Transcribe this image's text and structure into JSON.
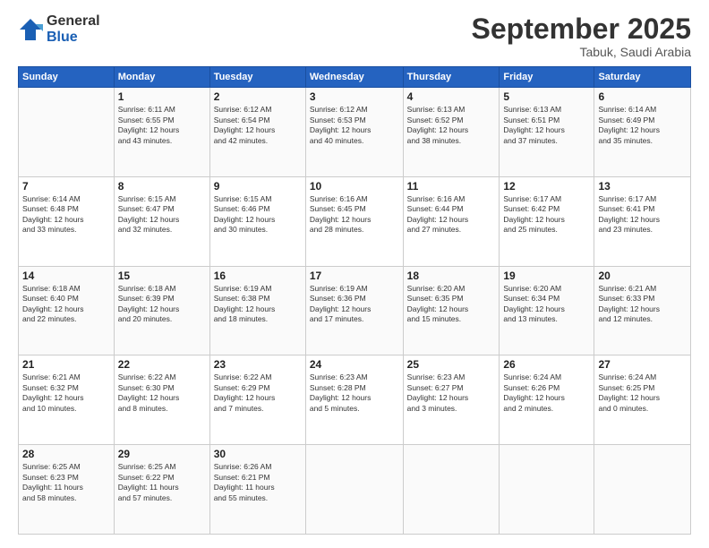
{
  "logo": {
    "general": "General",
    "blue": "Blue"
  },
  "header": {
    "month": "September 2025",
    "location": "Tabuk, Saudi Arabia"
  },
  "weekdays": [
    "Sunday",
    "Monday",
    "Tuesday",
    "Wednesday",
    "Thursday",
    "Friday",
    "Saturday"
  ],
  "weeks": [
    [
      {
        "day": "",
        "text": ""
      },
      {
        "day": "1",
        "text": "Sunrise: 6:11 AM\nSunset: 6:55 PM\nDaylight: 12 hours\nand 43 minutes."
      },
      {
        "day": "2",
        "text": "Sunrise: 6:12 AM\nSunset: 6:54 PM\nDaylight: 12 hours\nand 42 minutes."
      },
      {
        "day": "3",
        "text": "Sunrise: 6:12 AM\nSunset: 6:53 PM\nDaylight: 12 hours\nand 40 minutes."
      },
      {
        "day": "4",
        "text": "Sunrise: 6:13 AM\nSunset: 6:52 PM\nDaylight: 12 hours\nand 38 minutes."
      },
      {
        "day": "5",
        "text": "Sunrise: 6:13 AM\nSunset: 6:51 PM\nDaylight: 12 hours\nand 37 minutes."
      },
      {
        "day": "6",
        "text": "Sunrise: 6:14 AM\nSunset: 6:49 PM\nDaylight: 12 hours\nand 35 minutes."
      }
    ],
    [
      {
        "day": "7",
        "text": "Sunrise: 6:14 AM\nSunset: 6:48 PM\nDaylight: 12 hours\nand 33 minutes."
      },
      {
        "day": "8",
        "text": "Sunrise: 6:15 AM\nSunset: 6:47 PM\nDaylight: 12 hours\nand 32 minutes."
      },
      {
        "day": "9",
        "text": "Sunrise: 6:15 AM\nSunset: 6:46 PM\nDaylight: 12 hours\nand 30 minutes."
      },
      {
        "day": "10",
        "text": "Sunrise: 6:16 AM\nSunset: 6:45 PM\nDaylight: 12 hours\nand 28 minutes."
      },
      {
        "day": "11",
        "text": "Sunrise: 6:16 AM\nSunset: 6:44 PM\nDaylight: 12 hours\nand 27 minutes."
      },
      {
        "day": "12",
        "text": "Sunrise: 6:17 AM\nSunset: 6:42 PM\nDaylight: 12 hours\nand 25 minutes."
      },
      {
        "day": "13",
        "text": "Sunrise: 6:17 AM\nSunset: 6:41 PM\nDaylight: 12 hours\nand 23 minutes."
      }
    ],
    [
      {
        "day": "14",
        "text": "Sunrise: 6:18 AM\nSunset: 6:40 PM\nDaylight: 12 hours\nand 22 minutes."
      },
      {
        "day": "15",
        "text": "Sunrise: 6:18 AM\nSunset: 6:39 PM\nDaylight: 12 hours\nand 20 minutes."
      },
      {
        "day": "16",
        "text": "Sunrise: 6:19 AM\nSunset: 6:38 PM\nDaylight: 12 hours\nand 18 minutes."
      },
      {
        "day": "17",
        "text": "Sunrise: 6:19 AM\nSunset: 6:36 PM\nDaylight: 12 hours\nand 17 minutes."
      },
      {
        "day": "18",
        "text": "Sunrise: 6:20 AM\nSunset: 6:35 PM\nDaylight: 12 hours\nand 15 minutes."
      },
      {
        "day": "19",
        "text": "Sunrise: 6:20 AM\nSunset: 6:34 PM\nDaylight: 12 hours\nand 13 minutes."
      },
      {
        "day": "20",
        "text": "Sunrise: 6:21 AM\nSunset: 6:33 PM\nDaylight: 12 hours\nand 12 minutes."
      }
    ],
    [
      {
        "day": "21",
        "text": "Sunrise: 6:21 AM\nSunset: 6:32 PM\nDaylight: 12 hours\nand 10 minutes."
      },
      {
        "day": "22",
        "text": "Sunrise: 6:22 AM\nSunset: 6:30 PM\nDaylight: 12 hours\nand 8 minutes."
      },
      {
        "day": "23",
        "text": "Sunrise: 6:22 AM\nSunset: 6:29 PM\nDaylight: 12 hours\nand 7 minutes."
      },
      {
        "day": "24",
        "text": "Sunrise: 6:23 AM\nSunset: 6:28 PM\nDaylight: 12 hours\nand 5 minutes."
      },
      {
        "day": "25",
        "text": "Sunrise: 6:23 AM\nSunset: 6:27 PM\nDaylight: 12 hours\nand 3 minutes."
      },
      {
        "day": "26",
        "text": "Sunrise: 6:24 AM\nSunset: 6:26 PM\nDaylight: 12 hours\nand 2 minutes."
      },
      {
        "day": "27",
        "text": "Sunrise: 6:24 AM\nSunset: 6:25 PM\nDaylight: 12 hours\nand 0 minutes."
      }
    ],
    [
      {
        "day": "28",
        "text": "Sunrise: 6:25 AM\nSunset: 6:23 PM\nDaylight: 11 hours\nand 58 minutes."
      },
      {
        "day": "29",
        "text": "Sunrise: 6:25 AM\nSunset: 6:22 PM\nDaylight: 11 hours\nand 57 minutes."
      },
      {
        "day": "30",
        "text": "Sunrise: 6:26 AM\nSunset: 6:21 PM\nDaylight: 11 hours\nand 55 minutes."
      },
      {
        "day": "",
        "text": ""
      },
      {
        "day": "",
        "text": ""
      },
      {
        "day": "",
        "text": ""
      },
      {
        "day": "",
        "text": ""
      }
    ]
  ]
}
